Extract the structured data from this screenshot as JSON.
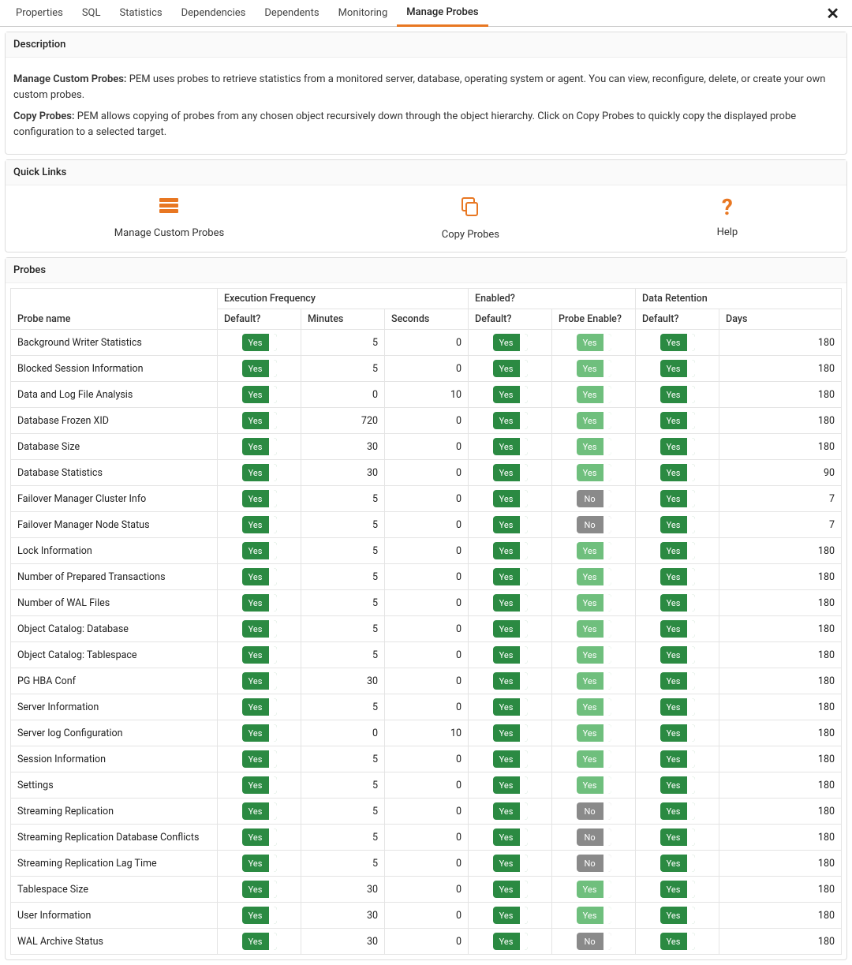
{
  "tabs": [
    "Properties",
    "SQL",
    "Statistics",
    "Dependencies",
    "Dependents",
    "Monitoring",
    "Manage Probes"
  ],
  "active_tab_index": 6,
  "description": {
    "title": "Description",
    "para1_label": "Manage Custom Probes:",
    "para1_text": "PEM uses probes to retrieve statistics from a monitored server, database, operating system or agent. You can view, reconfigure, delete, or create your own custom probes.",
    "para2_label": "Copy Probes:",
    "para2_text": "PEM allows copying of probes from any chosen object recursively down through the object hierarchy. Click on Copy Probes to quickly copy the displayed probe configuration to a selected target."
  },
  "quicklinks": {
    "title": "Quick Links",
    "items": [
      {
        "label": "Manage Custom Probes",
        "icon": "server-stack-icon"
      },
      {
        "label": "Copy Probes",
        "icon": "copy-icon"
      },
      {
        "label": "Help",
        "icon": "help-icon"
      }
    ]
  },
  "probes_section": {
    "title": "Probes",
    "group_headers": {
      "name": "",
      "exec": "Execution Frequency",
      "enabled": "Enabled?",
      "retention": "Data Retention"
    },
    "col_headers": {
      "name": "Probe name",
      "def1": "Default?",
      "min": "Minutes",
      "sec": "Seconds",
      "def2": "Default?",
      "pen": "Probe Enable?",
      "def3": "Default?",
      "days": "Days"
    },
    "toggle_labels": {
      "yes": "Yes",
      "no": "No"
    },
    "rows": [
      {
        "name": "Background Writer Statistics",
        "def1": true,
        "min": 5,
        "sec": 0,
        "def2": true,
        "pen": "yes-light",
        "def3": true,
        "days": 180
      },
      {
        "name": "Blocked Session Information",
        "def1": true,
        "min": 5,
        "sec": 0,
        "def2": true,
        "pen": "yes-light",
        "def3": true,
        "days": 180
      },
      {
        "name": "Data and Log File Analysis",
        "def1": true,
        "min": 0,
        "sec": 10,
        "def2": true,
        "pen": "yes-light",
        "def3": true,
        "days": 180
      },
      {
        "name": "Database Frozen XID",
        "def1": true,
        "min": 720,
        "sec": 0,
        "def2": true,
        "pen": "yes-light",
        "def3": true,
        "days": 180
      },
      {
        "name": "Database Size",
        "def1": true,
        "min": 30,
        "sec": 0,
        "def2": true,
        "pen": "yes-light",
        "def3": true,
        "days": 180
      },
      {
        "name": "Database Statistics",
        "def1": true,
        "min": 30,
        "sec": 0,
        "def2": true,
        "pen": "yes-light",
        "def3": true,
        "days": 90
      },
      {
        "name": "Failover Manager Cluster Info",
        "def1": true,
        "min": 5,
        "sec": 0,
        "def2": true,
        "pen": "no",
        "def3": true,
        "days": 7
      },
      {
        "name": "Failover Manager Node Status",
        "def1": true,
        "min": 5,
        "sec": 0,
        "def2": true,
        "pen": "no",
        "def3": true,
        "days": 7
      },
      {
        "name": "Lock Information",
        "def1": true,
        "min": 5,
        "sec": 0,
        "def2": true,
        "pen": "yes-light",
        "def3": true,
        "days": 180
      },
      {
        "name": "Number of Prepared Transactions",
        "def1": true,
        "min": 5,
        "sec": 0,
        "def2": true,
        "pen": "yes-light",
        "def3": true,
        "days": 180
      },
      {
        "name": "Number of WAL Files",
        "def1": true,
        "min": 5,
        "sec": 0,
        "def2": true,
        "pen": "yes-light",
        "def3": true,
        "days": 180
      },
      {
        "name": "Object Catalog: Database",
        "def1": true,
        "min": 5,
        "sec": 0,
        "def2": true,
        "pen": "yes-light",
        "def3": true,
        "days": 180
      },
      {
        "name": "Object Catalog: Tablespace",
        "def1": true,
        "min": 5,
        "sec": 0,
        "def2": true,
        "pen": "yes-light",
        "def3": true,
        "days": 180
      },
      {
        "name": "PG HBA Conf",
        "def1": true,
        "min": 30,
        "sec": 0,
        "def2": true,
        "pen": "yes-light",
        "def3": true,
        "days": 180
      },
      {
        "name": "Server Information",
        "def1": true,
        "min": 5,
        "sec": 0,
        "def2": true,
        "pen": "yes-light",
        "def3": true,
        "days": 180
      },
      {
        "name": "Server log Configuration",
        "def1": true,
        "min": 0,
        "sec": 10,
        "def2": true,
        "pen": "yes-light",
        "def3": true,
        "days": 180
      },
      {
        "name": "Session Information",
        "def1": true,
        "min": 5,
        "sec": 0,
        "def2": true,
        "pen": "yes-light",
        "def3": true,
        "days": 180
      },
      {
        "name": "Settings",
        "def1": true,
        "min": 5,
        "sec": 0,
        "def2": true,
        "pen": "yes-light",
        "def3": true,
        "days": 180
      },
      {
        "name": "Streaming Replication",
        "def1": true,
        "min": 5,
        "sec": 0,
        "def2": true,
        "pen": "no",
        "def3": true,
        "days": 180
      },
      {
        "name": "Streaming Replication Database Conflicts",
        "def1": true,
        "min": 5,
        "sec": 0,
        "def2": true,
        "pen": "no",
        "def3": true,
        "days": 180
      },
      {
        "name": "Streaming Replication Lag Time",
        "def1": true,
        "min": 5,
        "sec": 0,
        "def2": true,
        "pen": "no",
        "def3": true,
        "days": 180
      },
      {
        "name": "Tablespace Size",
        "def1": true,
        "min": 30,
        "sec": 0,
        "def2": true,
        "pen": "yes-light",
        "def3": true,
        "days": 180
      },
      {
        "name": "User Information",
        "def1": true,
        "min": 30,
        "sec": 0,
        "def2": true,
        "pen": "yes-light",
        "def3": true,
        "days": 180
      },
      {
        "name": "WAL Archive Status",
        "def1": true,
        "min": 30,
        "sec": 0,
        "def2": true,
        "pen": "no",
        "def3": true,
        "days": 180
      }
    ]
  }
}
